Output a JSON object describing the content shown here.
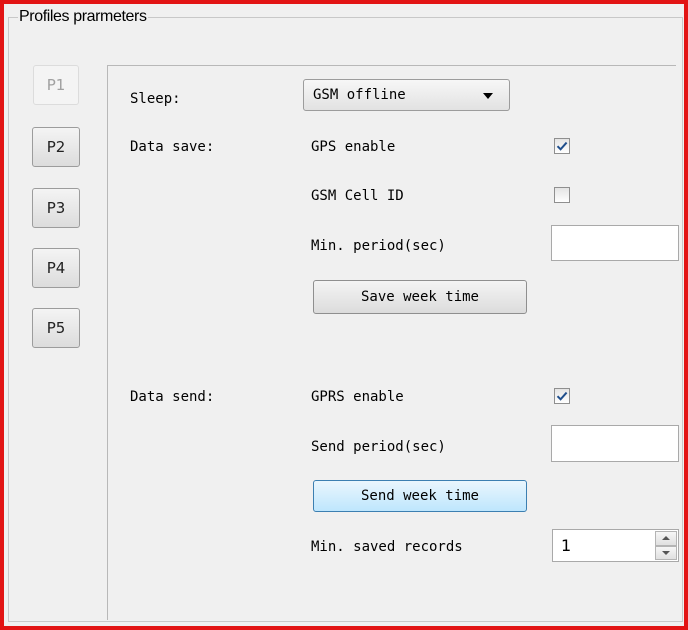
{
  "group": {
    "title": "Profiles prarmeters"
  },
  "profile_tabs": [
    {
      "label": "P1",
      "active": true
    },
    {
      "label": "P2",
      "active": false
    },
    {
      "label": "P3",
      "active": false
    },
    {
      "label": "P4",
      "active": false
    },
    {
      "label": "P5",
      "active": false
    }
  ],
  "sleep": {
    "label": "Sleep:",
    "selected": "GSM offline",
    "icon": "chevron-down-icon"
  },
  "data_save": {
    "label": "Data save:",
    "gps_enable": {
      "label": "GPS enable",
      "checked": true
    },
    "gsm_cell_id": {
      "label": "GSM Cell ID",
      "checked": false
    },
    "min_period": {
      "label": "Min. period(sec)",
      "value": ""
    },
    "week_button": "Save week time"
  },
  "data_send": {
    "label": "Data send:",
    "gprs_enable": {
      "label": "GPRS enable",
      "checked": true
    },
    "send_period": {
      "label": "Send period(sec)",
      "value": ""
    },
    "week_button": "Send week time",
    "min_saved_records": {
      "label": "Min. saved records",
      "value": "1"
    }
  },
  "colors": {
    "frame": "#e21414",
    "check": "#1f4e8c",
    "focus": "#3c7fb1"
  }
}
